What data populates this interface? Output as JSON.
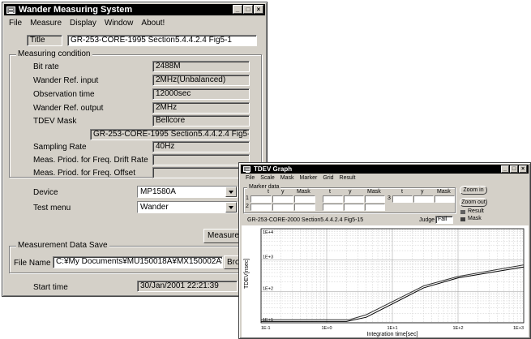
{
  "main_window": {
    "title": "Wander Measuring System",
    "menu": [
      "File",
      "Measure",
      "Display",
      "Window",
      "About!"
    ],
    "title_field": {
      "label": "Title",
      "value": "GR-253-CORE-1995 Section5.4.4.2.4 Fig5-1"
    },
    "measuring_condition": {
      "group_title": "Measuring condition",
      "rows": [
        {
          "label": "Bit rate",
          "value": "2488M"
        },
        {
          "label": "Wander Ref. input",
          "value": "2MHz(Unbalanced)"
        },
        {
          "label": "Observation time",
          "value": "12000sec"
        },
        {
          "label": "Wander Ref. output",
          "value": "2MHz"
        },
        {
          "label": "TDEV Mask",
          "value": "Bellcore"
        }
      ],
      "mask_detail": "GR-253-CORE-1995 Section5.4.4.2.4 Fig5-15",
      "rows2": [
        {
          "label": "Sampling Rate",
          "value": "40Hz"
        },
        {
          "label": "Meas. Priod. for Freq. Drift Rate",
          "value": ""
        },
        {
          "label": "Meas. Priod. for Freq. Offset",
          "value": ""
        }
      ]
    },
    "device": {
      "label": "Device",
      "value": "MP1580A"
    },
    "test_menu": {
      "label": "Test menu",
      "value": "Wander"
    },
    "measure_start_button": "Measure St",
    "data_save": {
      "group_title": "Measurement Data Save",
      "file_name_label": "File Name",
      "file_name_value": "C:¥My Documents¥MU150018A¥MX150002A¥test",
      "browse_button": "Brow"
    },
    "start_time": {
      "label": "Start time",
      "value": "30/Jan/2001 22:21:39"
    }
  },
  "graph_window": {
    "title": "TDEV Graph",
    "menu": [
      "File",
      "Scale",
      "Mask",
      "Marker",
      "Grid",
      "Result"
    ],
    "marker_data_label": "Marker data",
    "marker_headers": [
      "t",
      "y",
      "Mask",
      "t",
      "y",
      "Mask",
      "t",
      "y",
      "Mask"
    ],
    "row_labels": [
      "1",
      "2",
      "3"
    ],
    "zoom_in": "Zoom in",
    "zoom_out": "Zoom out",
    "legend": [
      "Result",
      "Mask"
    ],
    "caption": "GR-253-CORE-2000 Section5.4.4.2.4 Fig5-15",
    "judge_label": "Judge",
    "judge_value": "Fail",
    "y_axis_label": "TDEV[nsec]",
    "x_axis_label": "Integration time[sec]",
    "y_ticks": [
      "1E+4",
      "1E+3",
      "1E+2",
      "1E+1"
    ],
    "x_ticks": [
      "1E-1",
      "1E+0",
      "1E+1",
      "1E+2",
      "1E+3"
    ]
  },
  "chart_data": {
    "type": "line",
    "title": "",
    "xlabel": "Integration time[sec]",
    "ylabel": "TDEV[nsec]",
    "x_scale": "log",
    "y_scale": "log",
    "xlim": [
      0.1,
      1000
    ],
    "ylim": [
      10,
      10000
    ],
    "grid": true,
    "series": [
      {
        "name": "Mask",
        "x": [
          0.1,
          2.2,
          4,
          30,
          100,
          1000
        ],
        "y": [
          12.5,
          12.5,
          18,
          150,
          300,
          700
        ]
      },
      {
        "name": "Result",
        "x": [
          0.1,
          2,
          4,
          30,
          100,
          1000
        ],
        "y": [
          11,
          11,
          15,
          130,
          270,
          600
        ]
      }
    ]
  },
  "colors": {
    "window_face": "#d4d0c8",
    "title_bar": "#000000",
    "plot_bg": "#ffffff",
    "grid": "#c8c8c8"
  }
}
